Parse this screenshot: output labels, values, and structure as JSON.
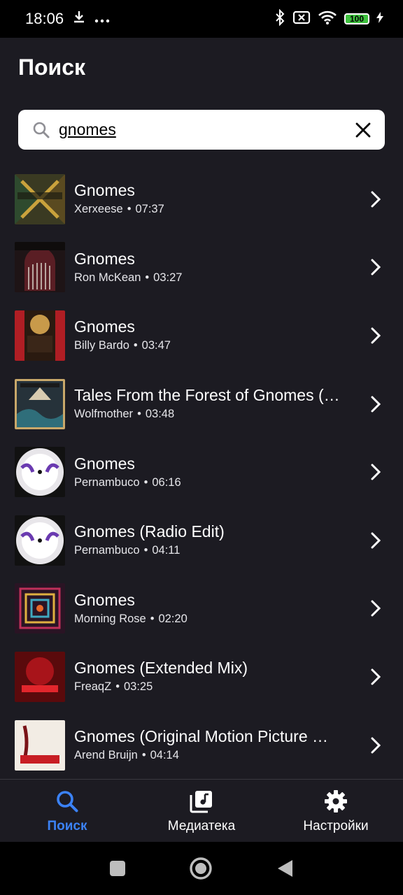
{
  "status_bar": {
    "time": "18:06",
    "battery": "100"
  },
  "page": {
    "title": "Поиск"
  },
  "search": {
    "value": "gnomes"
  },
  "results": [
    {
      "title": "Gnomes",
      "artist": "Xerxeese",
      "duration": "07:37"
    },
    {
      "title": "Gnomes",
      "artist": "Ron McKean",
      "duration": "03:27"
    },
    {
      "title": "Gnomes",
      "artist": "Billy Bardo",
      "duration": "03:47"
    },
    {
      "title": "Tales From the Forest of Gnomes (…",
      "artist": "Wolfmother",
      "duration": "03:48"
    },
    {
      "title": "Gnomes",
      "artist": "Pernambuco",
      "duration": "06:16"
    },
    {
      "title": "Gnomes (Radio Edit)",
      "artist": "Pernambuco",
      "duration": "04:11"
    },
    {
      "title": "Gnomes",
      "artist": "Morning Rose",
      "duration": "02:20"
    },
    {
      "title": "Gnomes (Extended Mix)",
      "artist": "FreaqZ",
      "duration": "03:25"
    },
    {
      "title": "Gnomes (Original Motion Picture …",
      "artist": "Arend Bruijn",
      "duration": "04:14"
    }
  ],
  "bottom_nav": {
    "search_label": "Поиск",
    "library_label": "Медиатека",
    "settings_label": "Настройки"
  },
  "colors": {
    "accent": "#3b82f6",
    "background": "#1c1b22"
  }
}
